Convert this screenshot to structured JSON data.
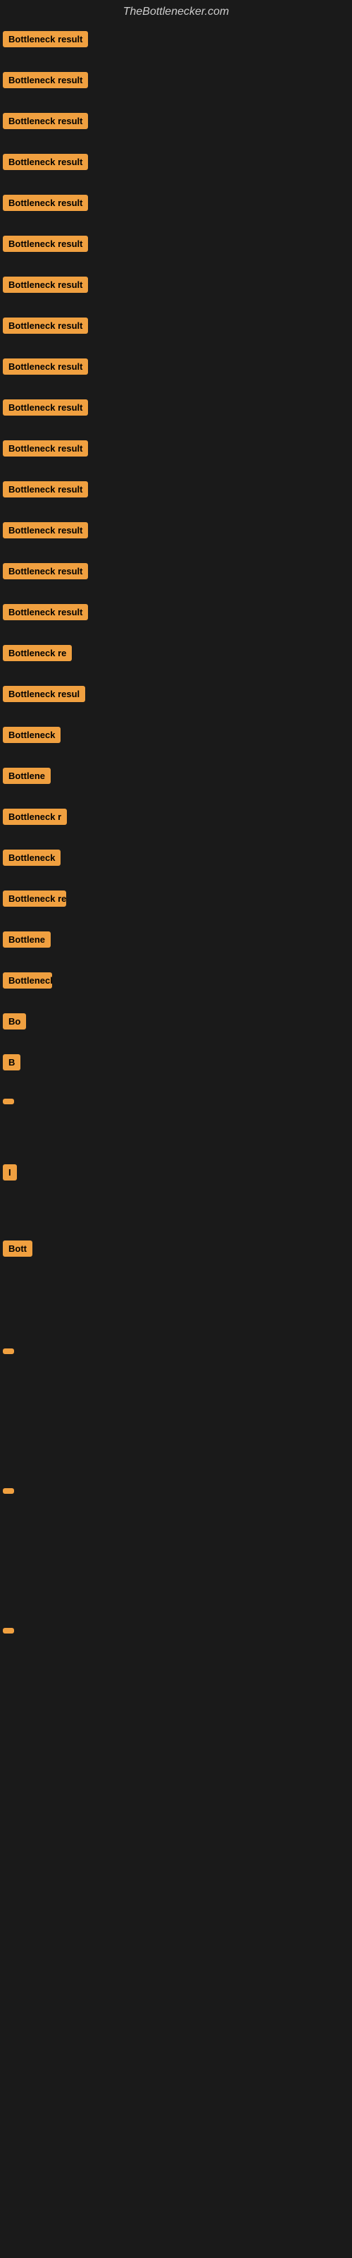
{
  "site": {
    "title": "TheBottlenecker.com"
  },
  "items": [
    {
      "id": 1,
      "label": "Bottleneck result",
      "size": "full",
      "spacer": 30
    },
    {
      "id": 2,
      "label": "Bottleneck result",
      "size": "full",
      "spacer": 30
    },
    {
      "id": 3,
      "label": "Bottleneck result",
      "size": "full",
      "spacer": 30
    },
    {
      "id": 4,
      "label": "Bottleneck result",
      "size": "full",
      "spacer": 30
    },
    {
      "id": 5,
      "label": "Bottleneck result",
      "size": "full",
      "spacer": 30
    },
    {
      "id": 6,
      "label": "Bottleneck result",
      "size": "full",
      "spacer": 30
    },
    {
      "id": 7,
      "label": "Bottleneck result",
      "size": "full",
      "spacer": 30
    },
    {
      "id": 8,
      "label": "Bottleneck result",
      "size": "full",
      "spacer": 30
    },
    {
      "id": 9,
      "label": "Bottleneck result",
      "size": "full",
      "spacer": 30
    },
    {
      "id": 10,
      "label": "Bottleneck result",
      "size": "full",
      "spacer": 30
    },
    {
      "id": 11,
      "label": "Bottleneck result",
      "size": "full",
      "spacer": 30
    },
    {
      "id": 12,
      "label": "Bottleneck result",
      "size": "full",
      "spacer": 30
    },
    {
      "id": 13,
      "label": "Bottleneck result",
      "size": "full",
      "spacer": 30
    },
    {
      "id": 14,
      "label": "Bottleneck result",
      "size": "full",
      "spacer": 30
    },
    {
      "id": 15,
      "label": "Bottleneck result",
      "size": "full",
      "spacer": 30
    },
    {
      "id": 16,
      "label": "Bottleneck re",
      "size": "lg",
      "spacer": 30
    },
    {
      "id": 17,
      "label": "Bottleneck resul",
      "size": "lg",
      "spacer": 30
    },
    {
      "id": 18,
      "label": "Bottleneck",
      "size": "md",
      "spacer": 30
    },
    {
      "id": 19,
      "label": "Bottlene",
      "size": "md",
      "spacer": 30
    },
    {
      "id": 20,
      "label": "Bottleneck r",
      "size": "md",
      "spacer": 30
    },
    {
      "id": 21,
      "label": "Bottleneck",
      "size": "sm",
      "spacer": 30
    },
    {
      "id": 22,
      "label": "Bottleneck re",
      "size": "sm",
      "spacer": 30
    },
    {
      "id": 23,
      "label": "Bottlene",
      "size": "sm",
      "spacer": 30
    },
    {
      "id": 24,
      "label": "Bottleneck",
      "size": "xs",
      "spacer": 30
    },
    {
      "id": 25,
      "label": "Bo",
      "size": "xs",
      "spacer": 30
    },
    {
      "id": 26,
      "label": "B",
      "size": "xxs",
      "spacer": 30
    },
    {
      "id": 27,
      "label": "",
      "size": "xxs",
      "spacer": 80
    },
    {
      "id": 28,
      "label": "I",
      "size": "tiny",
      "spacer": 80
    },
    {
      "id": 29,
      "label": "Bott",
      "size": "xs",
      "spacer": 120
    },
    {
      "id": 30,
      "label": "",
      "size": "micro",
      "spacer": 180
    },
    {
      "id": 31,
      "label": "",
      "size": "micro",
      "spacer": 180
    },
    {
      "id": 32,
      "label": "",
      "size": "micro",
      "spacer": 200
    }
  ]
}
